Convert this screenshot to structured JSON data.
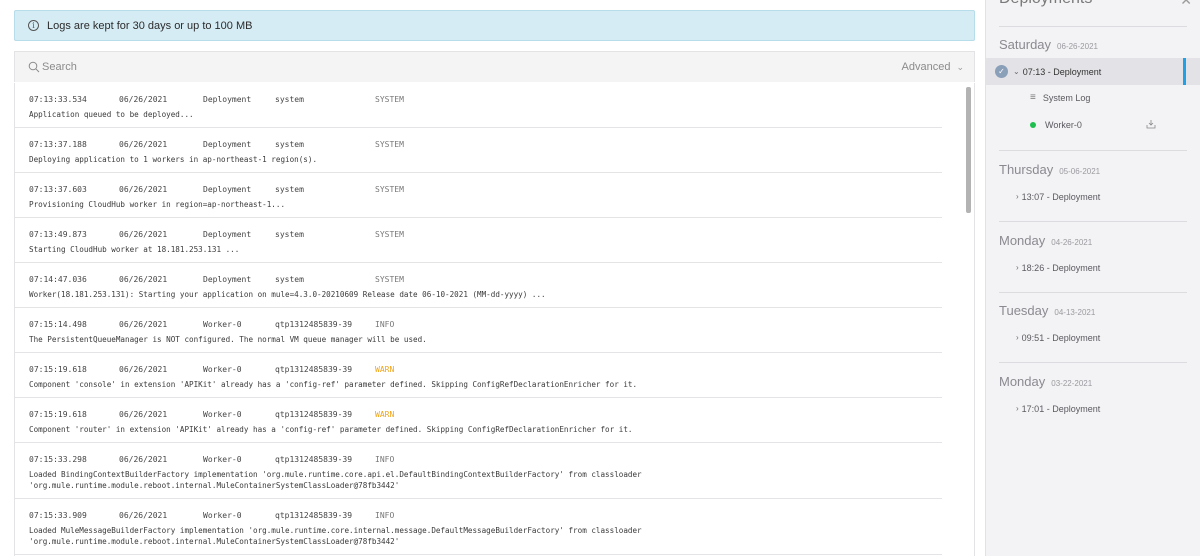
{
  "info_banner": {
    "icon": "info-icon",
    "text": "Logs are kept for 30 days or up to 100 MB"
  },
  "search": {
    "placeholder": "Search",
    "advanced_label": "Advanced"
  },
  "logs": [
    {
      "time": "07:13:33.534",
      "date": "06/26/2021",
      "source": "Deployment",
      "thread": "system",
      "level": "SYSTEM",
      "message": "Application queued to be deployed..."
    },
    {
      "time": "07:13:37.188",
      "date": "06/26/2021",
      "source": "Deployment",
      "thread": "system",
      "level": "SYSTEM",
      "message": "Deploying application to 1 workers in ap-northeast-1 region(s)."
    },
    {
      "time": "07:13:37.603",
      "date": "06/26/2021",
      "source": "Deployment",
      "thread": "system",
      "level": "SYSTEM",
      "message": "Provisioning CloudHub worker in region=ap-northeast-1..."
    },
    {
      "time": "07:13:49.873",
      "date": "06/26/2021",
      "source": "Deployment",
      "thread": "system",
      "level": "SYSTEM",
      "message": "Starting CloudHub worker at 18.181.253.131 ..."
    },
    {
      "time": "07:14:47.036",
      "date": "06/26/2021",
      "source": "Deployment",
      "thread": "system",
      "level": "SYSTEM",
      "message": "Worker(18.181.253.131): Starting your application on mule=4.3.0-20210609 Release date 06-10-2021 (MM-dd-yyyy) ..."
    },
    {
      "time": "07:15:14.498",
      "date": "06/26/2021",
      "source": "Worker-0",
      "thread": "qtp1312485839-39",
      "level": "INFO",
      "message": "The PersistentQueueManager is NOT configured. The normal VM queue manager will be used."
    },
    {
      "time": "07:15:19.618",
      "date": "06/26/2021",
      "source": "Worker-0",
      "thread": "qtp1312485839-39",
      "level": "WARN",
      "message": "Component 'console' in extension 'APIKit' already has a 'config-ref' parameter defined. Skipping ConfigRefDeclarationEnricher for it."
    },
    {
      "time": "07:15:19.618",
      "date": "06/26/2021",
      "source": "Worker-0",
      "thread": "qtp1312485839-39",
      "level": "WARN",
      "message": "Component 'router' in extension 'APIKit' already has a 'config-ref' parameter defined. Skipping ConfigRefDeclarationEnricher for it."
    },
    {
      "time": "07:15:33.298",
      "date": "06/26/2021",
      "source": "Worker-0",
      "thread": "qtp1312485839-39",
      "level": "INFO",
      "message": "Loaded BindingContextBuilderFactory implementation 'org.mule.runtime.core.api.el.DefaultBindingContextBuilderFactory' from classloader\n'org.mule.runtime.module.reboot.internal.MuleContainerSystemClassLoader@78fb3442'"
    },
    {
      "time": "07:15:33.909",
      "date": "06/26/2021",
      "source": "Worker-0",
      "thread": "qtp1312485839-39",
      "level": "INFO",
      "message": "Loaded MuleMessageBuilderFactory implementation 'org.mule.runtime.core.internal.message.DefaultMessageBuilderFactory' from classloader\n'org.mule.runtime.module.reboot.internal.MuleContainerSystemClassLoader@78fb3442'"
    }
  ],
  "sidebar": {
    "title": "Deployments",
    "days": [
      {
        "day": "Saturday",
        "date": "06-26-2021",
        "deployments": [
          "07:13 - Deployment"
        ]
      },
      {
        "day": "Thursday",
        "date": "05-06-2021",
        "deployments": [
          "13:07 - Deployment"
        ]
      },
      {
        "day": "Monday",
        "date": "04-26-2021",
        "deployments": [
          "18:26 - Deployment"
        ]
      },
      {
        "day": "Tuesday",
        "date": "04-13-2021",
        "deployments": [
          "09:51 - Deployment"
        ]
      },
      {
        "day": "Monday",
        "date": "03-22-2021",
        "deployments": [
          "17:01 - Deployment"
        ]
      }
    ],
    "expanded": {
      "system_log_label": "System Log",
      "worker_label": "Worker-0"
    }
  },
  "colors": {
    "warn": "#f0a518",
    "accent": "#1ea1e6",
    "worker_status": "#1fbf4f",
    "banner_bg": "#d6ecf5"
  }
}
